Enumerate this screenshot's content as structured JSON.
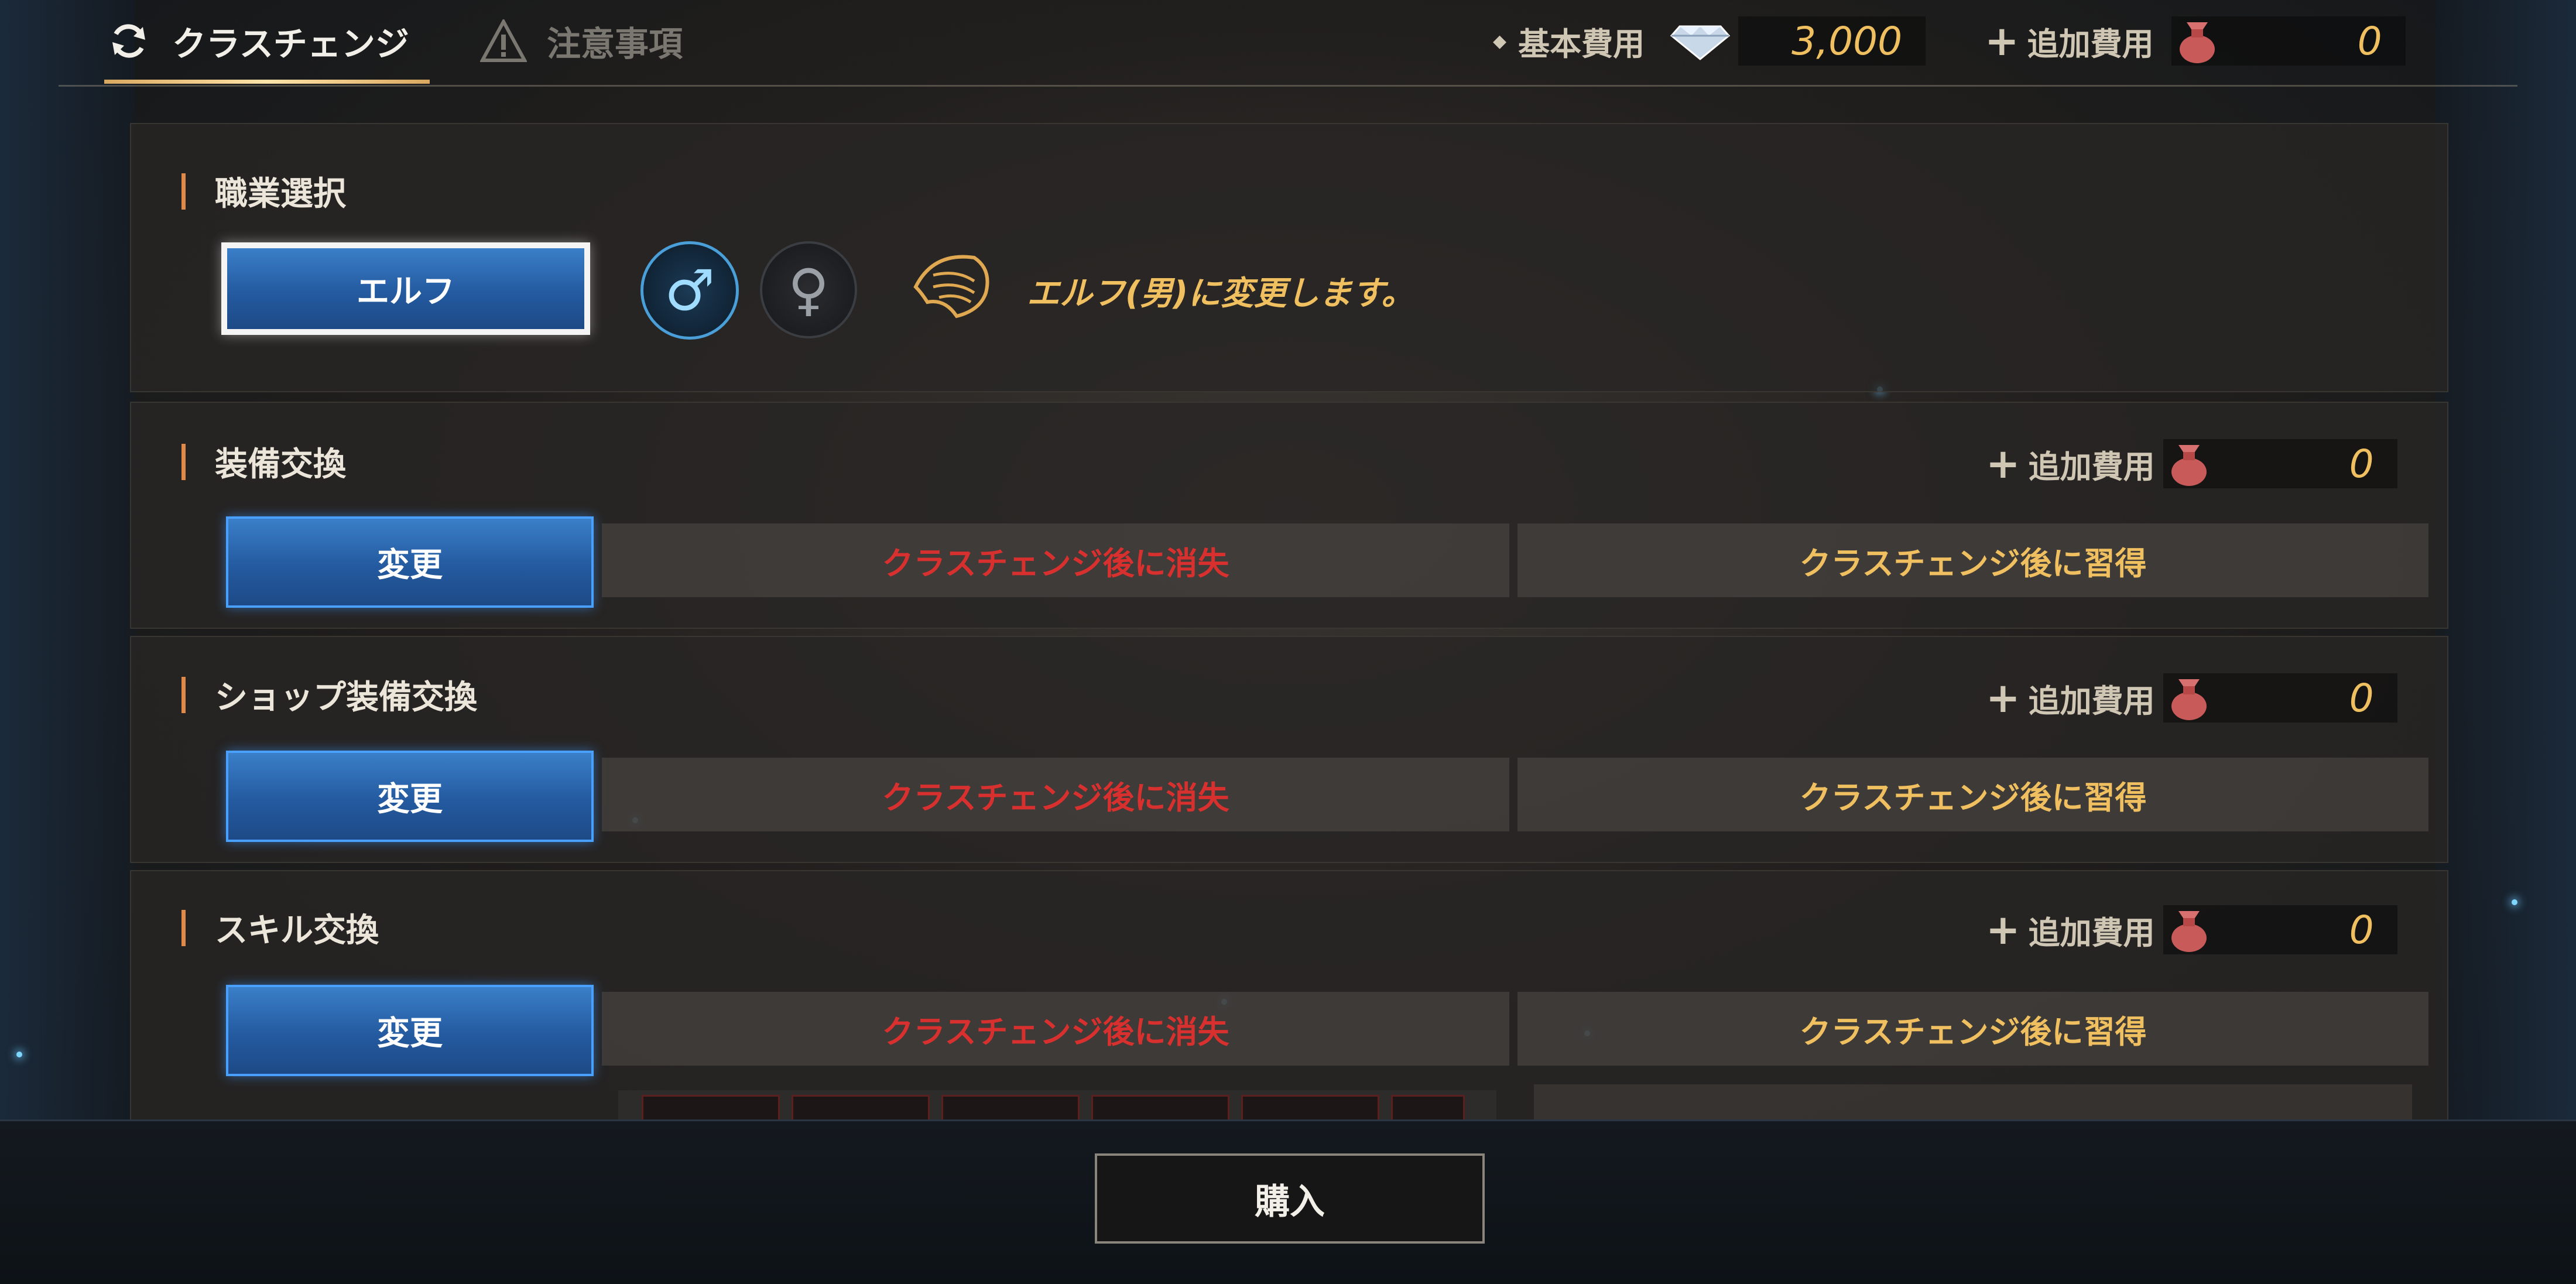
{
  "tabs": {
    "class_change": "クラスチェンジ",
    "warnings": "注意事項"
  },
  "header_costs": {
    "base_label": "基本費用",
    "base_value": "3,000",
    "extra_label": "追加費用",
    "extra_value": "0"
  },
  "job_select": {
    "title": "職業選択",
    "class_button": "エルフ",
    "male_symbol": "♂",
    "female_symbol": "♀",
    "selected_gender": "male",
    "description": "エルフ(男)に変更します。"
  },
  "sections": [
    {
      "title": "装備交換",
      "extra_label": "追加費用",
      "extra_value": "0",
      "change_button": "変更",
      "lost_label": "クラスチェンジ後に消失",
      "gained_label": "クラスチェンジ後に習得"
    },
    {
      "title": "ショップ装備交換",
      "extra_label": "追加費用",
      "extra_value": "0",
      "change_button": "変更",
      "lost_label": "クラスチェンジ後に消失",
      "gained_label": "クラスチェンジ後に習得"
    },
    {
      "title": "スキル交換",
      "extra_label": "追加費用",
      "extra_value": "0",
      "change_button": "変更",
      "lost_label": "クラスチェンジ後に消失",
      "gained_label": "クラスチェンジ後に習得"
    }
  ],
  "purchase_button": "購入",
  "colors": {
    "accent_gold": "#f0c060",
    "lost_red": "#d8302e",
    "button_blue": "#245aa0",
    "section_marker": "#e08a4a"
  }
}
